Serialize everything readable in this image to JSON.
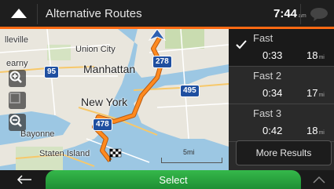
{
  "header": {
    "title": "Alternative Routes",
    "time": "7:44",
    "ampm": "am"
  },
  "map": {
    "labels": [
      "lleville",
      "Union City",
      "earny",
      "Manhattan",
      "New York",
      "Bayonne",
      "Staten Island"
    ],
    "shields": [
      "95",
      "278",
      "495",
      "478"
    ],
    "scale": "5mi"
  },
  "routes": [
    {
      "name": "Fast",
      "time": "0:33",
      "distance": "18",
      "unit": "mi",
      "selected": true
    },
    {
      "name": "Fast 2",
      "time": "0:34",
      "distance": "17",
      "unit": "mi",
      "selected": false
    },
    {
      "name": "Fast 3",
      "time": "0:42",
      "distance": "18",
      "unit": "mi",
      "selected": false
    }
  ],
  "more_results_label": "More Results",
  "bottom": {
    "select_label": "Select"
  },
  "colors": {
    "accent": "#ff6a13",
    "select": "#2aa63f",
    "route": "#ff8a1f",
    "water": "#9cc7e3",
    "highway": "#1f4fa0"
  }
}
